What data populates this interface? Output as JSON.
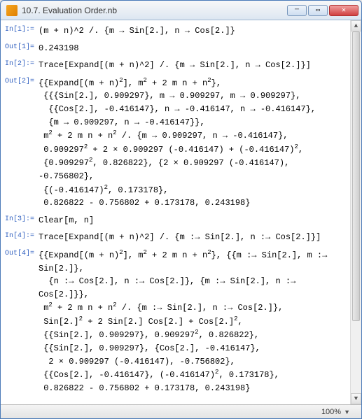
{
  "window": {
    "title": "10.7. Evaluation Order.nb"
  },
  "cells": [
    {
      "label": "In[1]:=",
      "content_html": "(m + n)^2 /. {m → Sin[2.], n → Cos[2.]}"
    },
    {
      "label": "Out[1]=",
      "content_html": "0.243198"
    },
    {
      "label": "In[2]:=",
      "content_html": "Trace[Expand[(m + n)^2] /. {m → Sin[2.], n → Cos[2.]}]"
    },
    {
      "label": "Out[2]=",
      "content_html": "{{Expand[(m + n)<sup>2</sup>], m<sup>2</sup> + 2 m n + n<sup>2</sup>},\n {{{Sin[2.], 0.909297}, m → 0.909297, m → 0.909297},\n  {{Cos[2.], -0.416147}, n → -0.416147, n → -0.416147},\n  {m → 0.909297, n → -0.416147}},\n m<sup>2</sup> + 2 m n + n<sup>2</sup> /. {m → 0.909297, n → -0.416147},\n 0.909297<sup>2</sup> + 2 × 0.909297 (-0.416147) + (-0.416147)<sup>2</sup>,\n {0.909297<sup>2</sup>, 0.826822}, {2 × 0.909297 (-0.416147), -0.756802},\n {(-0.416147)<sup>2</sup>, 0.173178},\n 0.826822 - 0.756802 + 0.173178, 0.243198}"
    },
    {
      "label": "In[3]:=",
      "content_html": "Clear[m, n]"
    },
    {
      "label": "In[4]:=",
      "content_html": "Trace[Expand[(m + n)^2] /. {m :→ Sin[2.], n :→ Cos[2.]}]"
    },
    {
      "label": "Out[4]=",
      "content_html": "{{Expand[(m + n)<sup>2</sup>], m<sup>2</sup> + 2 m n + n<sup>2</sup>}, {{m :→ Sin[2.], m :→ Sin[2.]},\n  {n :→ Cos[2.], n :→ Cos[2.]}, {m :→ Sin[2.], n :→ Cos[2.]}},\n m<sup>2</sup> + 2 m n + n<sup>2</sup> /. {m :→ Sin[2.], n :→ Cos[2.]},\n Sin[2.]<sup>2</sup> + 2 Sin[2.] Cos[2.] + Cos[2.]<sup>2</sup>,\n {{Sin[2.], 0.909297}, 0.909297<sup>2</sup>, 0.826822},\n {{Sin[2.], 0.909297}, {Cos[2.], -0.416147},\n  2 × 0.909297 (-0.416147), -0.756802},\n {{Cos[2.], -0.416147}, (-0.416147)<sup>2</sup>, 0.173178},\n 0.826822 - 0.756802 + 0.173178, 0.243198}"
    }
  ],
  "status": {
    "zoom": "100%"
  }
}
